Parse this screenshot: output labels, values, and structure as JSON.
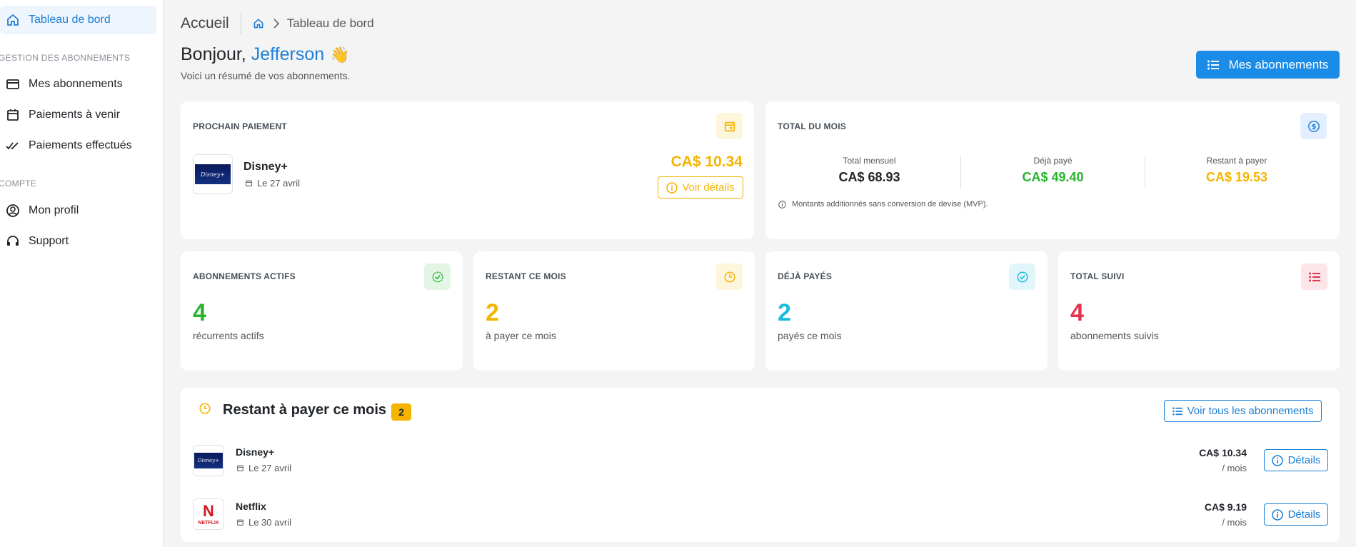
{
  "sidebar": {
    "items": [
      {
        "label": "Tableau de bord",
        "icon": "home-icon",
        "active": true
      },
      {
        "label": "Mes abonnements",
        "icon": "credit-card-icon"
      },
      {
        "label": "Paiements à venir",
        "icon": "calendar-icon"
      },
      {
        "label": "Paiements effectués",
        "icon": "double-check-icon"
      },
      {
        "label": "Mon profil",
        "icon": "user-circle-icon"
      },
      {
        "label": "Support",
        "icon": "headset-icon"
      }
    ],
    "sections": [
      "GESTION DES ABONNEMENTS",
      "COMPTE"
    ]
  },
  "breadcrumb": {
    "home": "Accueil",
    "current": "Tableau de bord"
  },
  "header": {
    "greeting": "Bonjour,",
    "user_name": "Jefferson",
    "wave": "👋",
    "subtitle": "Voici un résumé de vos abonnements.",
    "primary_button": "Mes abonnements"
  },
  "next_payment": {
    "title": "PROCHAIN PAIEMENT",
    "service": "Disney+",
    "logo_text": "Disney+",
    "date": "Le 27 avril",
    "amount": "CA$ 10.34",
    "details_button": "Voir détails"
  },
  "month_total": {
    "title": "TOTAL DU MOIS",
    "stats": [
      {
        "label": "Total mensuel",
        "value": "CA$ 68.93",
        "color": "#212529"
      },
      {
        "label": "Déjà payé",
        "value": "CA$ 49.40",
        "color": "#28b42c"
      },
      {
        "label": "Restant à payer",
        "value": "CA$ 19.53",
        "color": "#f5b400"
      }
    ],
    "note": "Montants additionnés sans conversion de devise (MVP)."
  },
  "stat_cards": [
    {
      "title": "ABONNEMENTS ACTIFS",
      "value": "4",
      "desc": "récurrents actifs",
      "color": "#28b42c",
      "badge_bg": "#e3f5e4",
      "icon": "check-badge-icon"
    },
    {
      "title": "RESTANT CE MOIS",
      "value": "2",
      "desc": "à payer ce mois",
      "color": "#f5b400",
      "badge_bg": "#fdf5dc",
      "icon": "clock-icon"
    },
    {
      "title": "DÉJÀ PAYÉS",
      "value": "2",
      "desc": "payés ce mois",
      "color": "#17bde0",
      "badge_bg": "#e1f6fb",
      "icon": "check-circle-icon"
    },
    {
      "title": "TOTAL SUIVI",
      "value": "4",
      "desc": "abonnements suivis",
      "color": "#e2344e",
      "badge_bg": "#fbe5e8",
      "icon": "list-icon"
    }
  ],
  "remaining": {
    "title": "Restant à payer ce mois",
    "count": "2",
    "view_all_button": "Voir tous les abonnements",
    "items": [
      {
        "name": "Disney+",
        "date": "Le 27 avril",
        "amount": "CA$ 10.34",
        "period": "/ mois",
        "button": "Détails",
        "logo": "Disney+"
      },
      {
        "name": "Netflix",
        "date": "Le 30 avril",
        "amount": "CA$ 9.19",
        "period": "/ mois",
        "button": "Détails",
        "logo_n": "N",
        "logo_word": "NETFLIX"
      }
    ]
  },
  "colors": {
    "accent": "#1a8ce8",
    "yellow": "#f5b400",
    "green": "#28b42c",
    "cyan": "#17bde0",
    "red": "#e2344e"
  }
}
